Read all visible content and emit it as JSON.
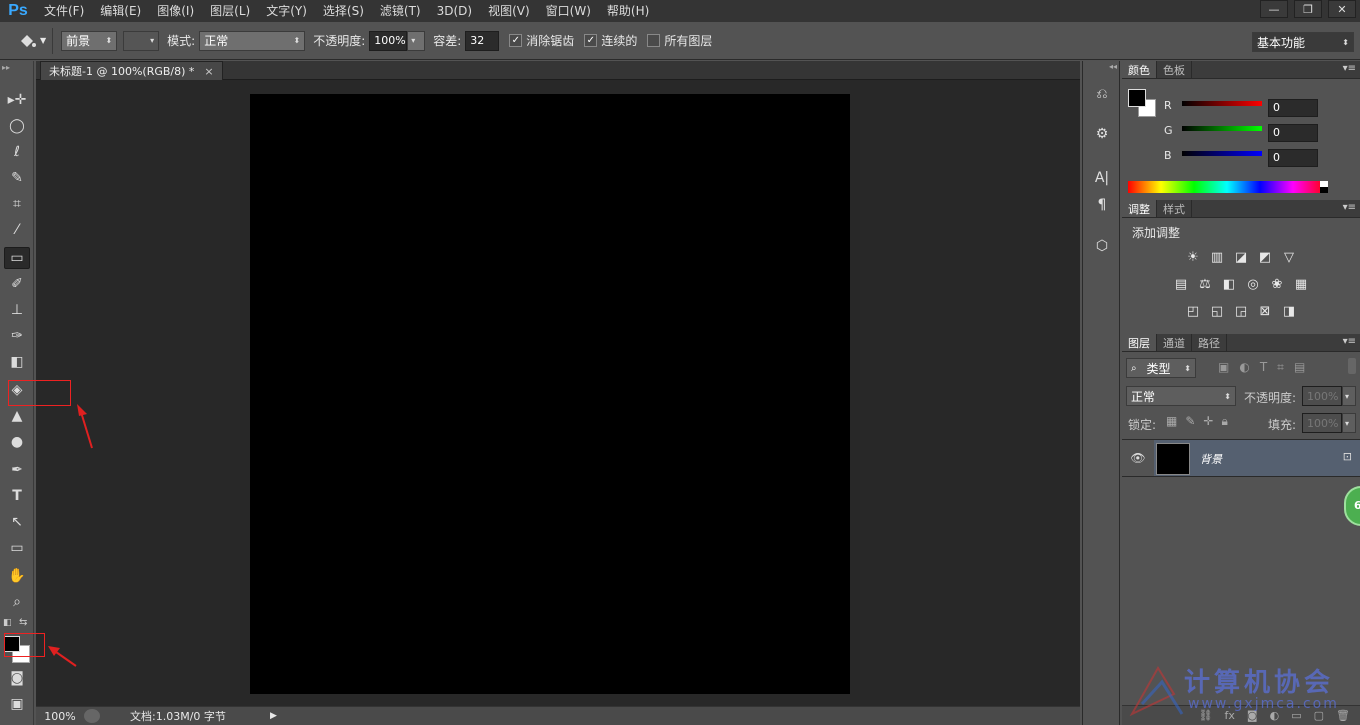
{
  "app": {
    "logo": "Ps"
  },
  "menu": [
    "文件(F)",
    "编辑(E)",
    "图像(I)",
    "图层(L)",
    "文字(Y)",
    "选择(S)",
    "滤镜(T)",
    "3D(D)",
    "视图(V)",
    "窗口(W)",
    "帮助(H)"
  ],
  "options": {
    "fill_source": "前景",
    "mode_label": "模式:",
    "mode_value": "正常",
    "opacity_label": "不透明度:",
    "opacity_value": "100%",
    "tolerance_label": "容差:",
    "tolerance_value": "32",
    "antialias_label": "消除锯齿",
    "contiguous_label": "连续的",
    "alllayers_label": "所有图层",
    "workspace": "基本功能"
  },
  "document": {
    "tab_title": "未标题-1 @ 100%(RGB/8) *",
    "zoom": "100%",
    "doc_info": "文档:1.03M/0 字节"
  },
  "color_panel": {
    "tabs": [
      "颜色",
      "色板"
    ],
    "r_label": "R",
    "g_label": "G",
    "b_label": "B",
    "r": "0",
    "g": "0",
    "b": "0"
  },
  "adjust_panel": {
    "tabs": [
      "调整",
      "样式"
    ],
    "heading": "添加调整"
  },
  "layers_panel": {
    "tabs": [
      "图层",
      "通道",
      "路径"
    ],
    "filter": "类型",
    "blend": "正常",
    "opacity_label": "不透明度:",
    "opacity": "100%",
    "lock_label": "锁定:",
    "fill_label": "填充:",
    "fill": "100%",
    "layer_name": "背景"
  },
  "badge": "6",
  "watermark": {
    "title": "计算机协会",
    "url": "www.gxjmca.com"
  },
  "colors": {
    "annotation": "#e02020",
    "selected_layer": "#556070",
    "brand": "#39a9ff"
  }
}
